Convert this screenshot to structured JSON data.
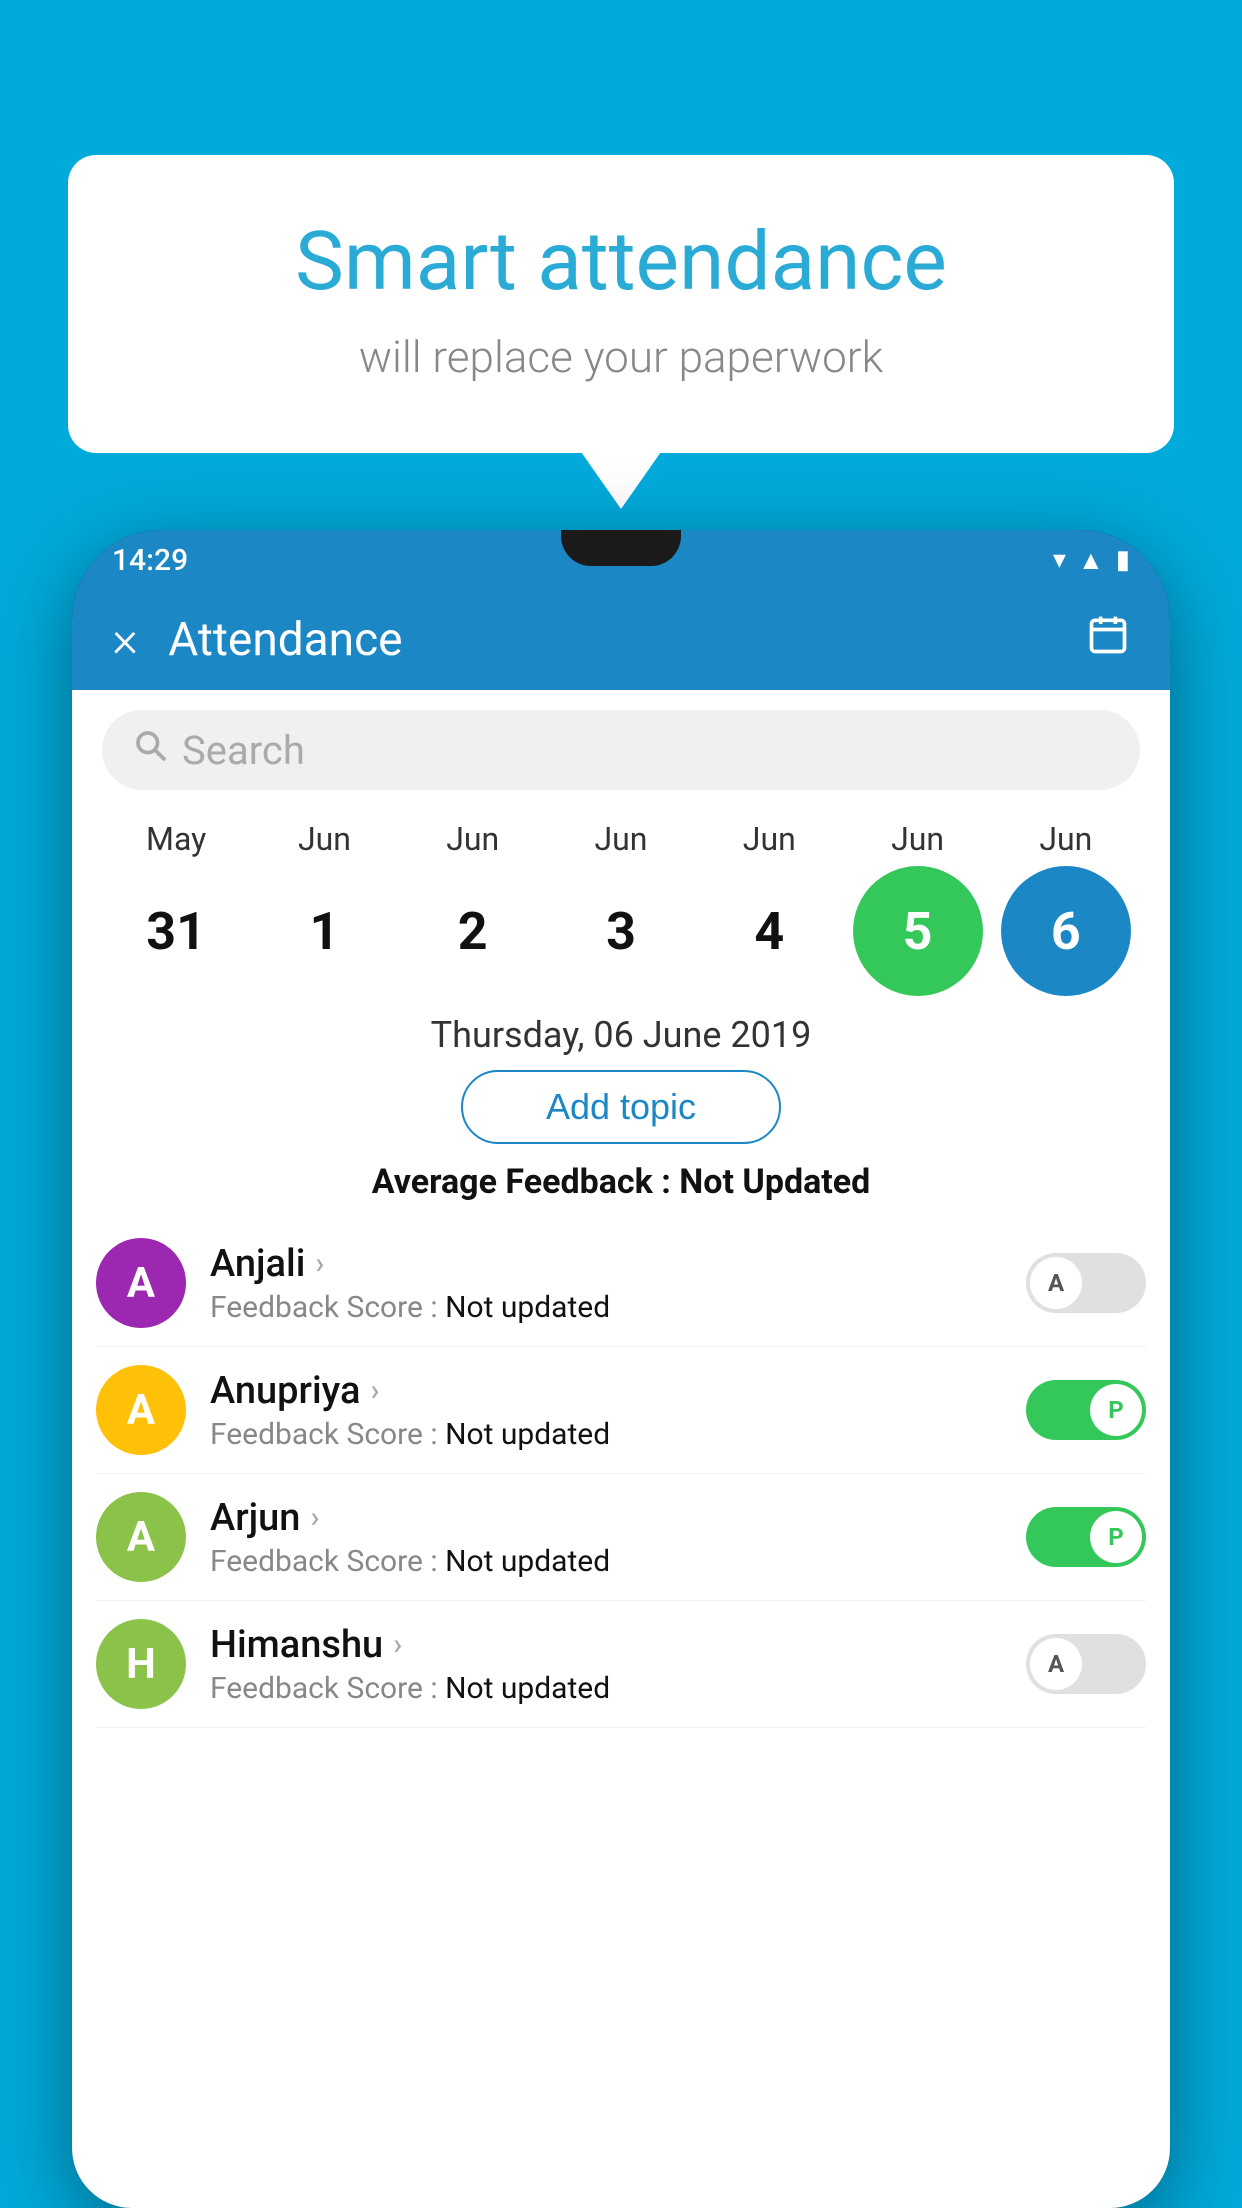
{
  "background_color": "#00AADB",
  "speech_bubble": {
    "title": "Smart attendance",
    "subtitle": "will replace your paperwork"
  },
  "status_bar": {
    "time": "14:29"
  },
  "app_header": {
    "title": "Attendance",
    "close_label": "×",
    "calendar_icon": "📅"
  },
  "search": {
    "placeholder": "Search"
  },
  "calendar": {
    "months": [
      "May",
      "Jun",
      "Jun",
      "Jun",
      "Jun",
      "Jun",
      "Jun"
    ],
    "days": [
      "31",
      "1",
      "2",
      "3",
      "4",
      "5",
      "6"
    ],
    "states": [
      "normal",
      "normal",
      "normal",
      "normal",
      "normal",
      "today",
      "selected"
    ]
  },
  "selected_date": "Thursday, 06 June 2019",
  "add_topic_label": "Add topic",
  "average_feedback": {
    "label": "Average Feedback : ",
    "value": "Not Updated"
  },
  "students": [
    {
      "name": "Anjali",
      "initial": "A",
      "avatar_color": "#9C27B0",
      "feedback_label": "Feedback Score : ",
      "feedback_value": "Not updated",
      "toggle": "off",
      "toggle_label": "A"
    },
    {
      "name": "Anupriya",
      "initial": "A",
      "avatar_color": "#FFC107",
      "feedback_label": "Feedback Score : ",
      "feedback_value": "Not updated",
      "toggle": "on",
      "toggle_label": "P"
    },
    {
      "name": "Arjun",
      "initial": "A",
      "avatar_color": "#8BC34A",
      "feedback_label": "Feedback Score : ",
      "feedback_value": "Not updated",
      "toggle": "on",
      "toggle_label": "P"
    },
    {
      "name": "Himanshu",
      "initial": "H",
      "avatar_color": "#8BC34A",
      "feedback_label": "Feedback Score : ",
      "feedback_value": "Not updated",
      "toggle": "off",
      "toggle_label": "A"
    }
  ]
}
